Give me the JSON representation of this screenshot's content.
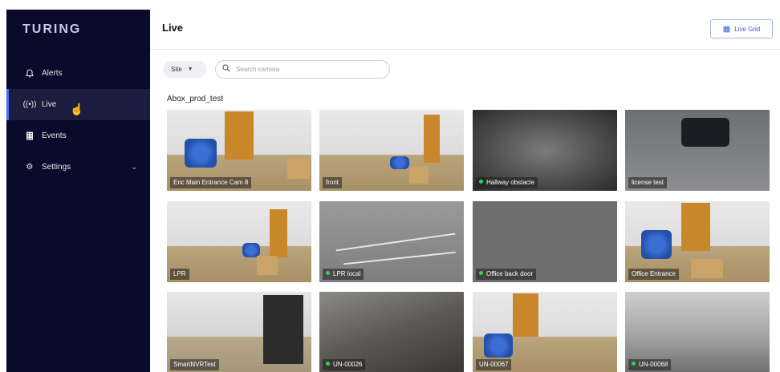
{
  "app": {
    "logo": "TURING"
  },
  "sidebar": {
    "items": [
      {
        "label": "Alerts",
        "icon": "bell-icon"
      },
      {
        "label": "Live",
        "icon": "broadcast-icon",
        "active": true
      },
      {
        "label": "Events",
        "icon": "film-icon"
      },
      {
        "label": "Settings",
        "icon": "gear-icon",
        "expandable": true
      }
    ]
  },
  "header": {
    "title": "Live",
    "live_grid_label": "Live Grid"
  },
  "filters": {
    "site_label": "Site",
    "search_placeholder": "Search camera"
  },
  "group": {
    "name": "Abox_prod_test"
  },
  "cameras": [
    {
      "name": "Eric Main Entrance Cam 8",
      "online_dot": false
    },
    {
      "name": "front",
      "online_dot": false
    },
    {
      "name": "Hallway obstacle",
      "online_dot": true
    },
    {
      "name": "license test",
      "online_dot": false,
      "selected": true
    },
    {
      "name": "LPR",
      "online_dot": false
    },
    {
      "name": "LPR local",
      "online_dot": true
    },
    {
      "name": "Office back door",
      "online_dot": true
    },
    {
      "name": "Office Entrance",
      "online_dot": false
    },
    {
      "name": "SmartNVRTest",
      "online_dot": false
    },
    {
      "name": "UN-00026",
      "online_dot": true
    },
    {
      "name": "UN-00067",
      "online_dot": false
    },
    {
      "name": "UN-00068",
      "online_dot": true
    }
  ],
  "colors": {
    "sidebar_bg": "#0a0a2a",
    "accent": "#3b5bdb",
    "online": "#33d05a",
    "selected_border": "#e0202a"
  }
}
